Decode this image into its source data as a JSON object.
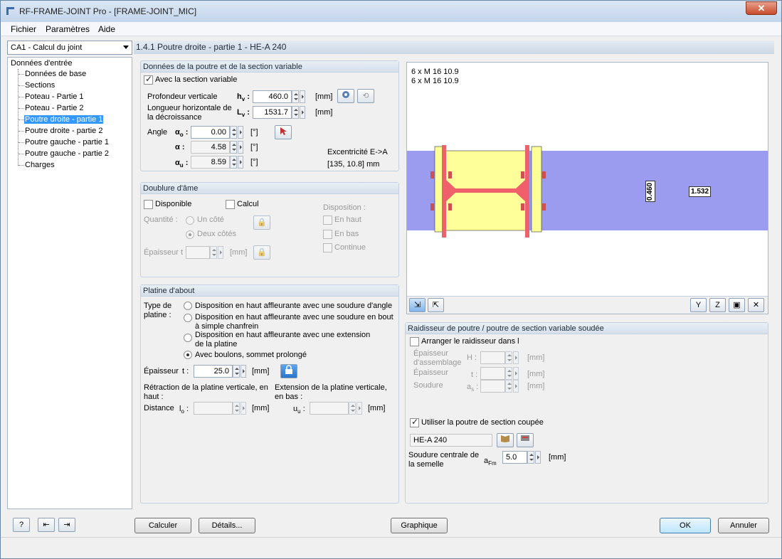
{
  "window": {
    "title": "RF-FRAME-JOINT Pro - [FRAME-JOINT_MIC]",
    "close": "✕"
  },
  "menu": [
    "Fichier",
    "Paramètres",
    "Aide"
  ],
  "case_combo": "CA1 - Calcul du joint",
  "tree": {
    "root": "Données d'entrée",
    "items": [
      "Données de base",
      "Sections",
      "Poteau - Partie 1",
      "Poteau - Partie 2",
      "Poutre droite - partie 1",
      "Poutre droite - partie 2",
      "Poutre gauche - partie 1",
      "Poutre gauche - partie 2",
      "Charges"
    ],
    "selected_index": 4
  },
  "main_header": "1.4.1 Poutre droite - partie 1 - HE-A 240",
  "beam_group": {
    "title": "Données de la poutre et de la section variable",
    "variable_section_label": "Avec la section variable",
    "variable_section_checked": true,
    "depth_label": "Profondeur verticale",
    "depth_symbol": "h",
    "depth_sub": "v",
    "depth_value": "460.0",
    "depth_unit": "[mm]",
    "length_label": "Longueur horizontale de la décroissance",
    "length_symbol": "L",
    "length_sub": "v",
    "length_value": "1531.7",
    "length_unit": "[mm]",
    "angle_label": "Angle",
    "alpha_o_symbol": "α",
    "alpha_o_sub": "o",
    "alpha_o_value": "0.00",
    "alpha_symbol": "α :",
    "alpha_value": "4.58",
    "alpha_u_symbol": "α",
    "alpha_u_sub": "u",
    "alpha_u_value": "8.59",
    "angle_unit": "[°]",
    "eccentricity_label": "Excentricité E->A",
    "eccentricity_value": "[135, 10.8]",
    "eccentricity_unit": "mm"
  },
  "web_group": {
    "title": "Doublure d'âme",
    "available_label": "Disponible",
    "calc_label": "Calcul",
    "quantity_label": "Quantité :",
    "one_side": "Un côté",
    "two_sides": "Deux côtés",
    "thickness_label": "Épaisseur t :",
    "thickness_unit": "[mm]",
    "disposition_label": "Disposition :",
    "top": "En haut",
    "bottom": "En bas",
    "continuous": "Continue"
  },
  "plate_group": {
    "title": "Platine d'about",
    "type_label": "Type de platine :",
    "options": [
      "Disposition en haut affleurante avec une soudure d'angle",
      "Disposition en haut affleurante avec une soudure en bout à simple chanfrein",
      "Disposition en haut affleurante avec une extension de la platine",
      "Avec boulons, sommet prolongé"
    ],
    "selected_option": 3,
    "thickness_label": "Épaisseur",
    "thickness_symbol": "t :",
    "thickness_value": "25.0",
    "thickness_unit": "[mm]",
    "retraction_label": "Rétraction de la platine verticale, en haut :",
    "extension_label": "Extension de la platine verticale, en bas :",
    "distance_label": "Distance",
    "lo_symbol": "l",
    "lo_sub": "o",
    "uu_symbol": "u",
    "uu_sub": "u",
    "unit": "[mm]"
  },
  "graphic": {
    "bolt_line1": "6 x M 16 10.9",
    "bolt_line2": "6 x M 16 10.9",
    "dim_vertical": "0.460",
    "dim_horizontal": "1.532",
    "colors": {
      "beam": "#9b9bf0",
      "plate": "#f0606a",
      "column": "#ffff99",
      "bolt": "#d05050"
    }
  },
  "stiffener_group": {
    "title": "Raidisseur de poutre / poutre de section variable soudée",
    "arrange_label": "Arranger le raidisseur dans l",
    "assembly_thickness_label": "Épaisseur d'assemblage",
    "h_symbol": "H :",
    "thickness_label": "Épaisseur",
    "t_symbol": "t :",
    "weld_label": "Soudure",
    "as_symbol": "a",
    "as_sub": "s",
    "unit": "[mm]",
    "cut_beam_label": "Utiliser la poutre de section coupée",
    "cut_beam_checked": true,
    "section_value": "HE-A 240",
    "central_weld_label": "Soudure centrale de la semelle",
    "afm_symbol": "a",
    "afm_sub": "Fm",
    "afm_value": "5.0",
    "afm_unit": "[mm]"
  },
  "buttons": {
    "calculate": "Calculer",
    "details": "Détails...",
    "graphic": "Graphique",
    "ok": "OK",
    "cancel": "Annuler"
  }
}
